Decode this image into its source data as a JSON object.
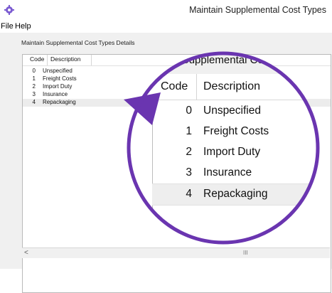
{
  "window": {
    "title": "Maintain Supplemental Cost Types"
  },
  "menu": [
    {
      "label": "File"
    },
    {
      "label": "Help"
    }
  ],
  "group": {
    "label": "Maintain Supplemental Cost Types Details"
  },
  "grid": {
    "columns": [
      "Code",
      "Description"
    ],
    "rows": [
      {
        "code": "0",
        "description": "Unspecified"
      },
      {
        "code": "1",
        "description": "Freight Costs"
      },
      {
        "code": "2",
        "description": "Import Duty"
      },
      {
        "code": "3",
        "description": "Insurance"
      },
      {
        "code": "4",
        "description": "Repackaging"
      }
    ],
    "selected_index": 4
  },
  "scrollbar": {
    "left_arrow": "<",
    "thumb": "III"
  },
  "zoom": {
    "title_fragment": "itain Supplemental Cost",
    "accent_color": "#6a35b0"
  },
  "icons": {
    "app": "app-gear-icon"
  }
}
